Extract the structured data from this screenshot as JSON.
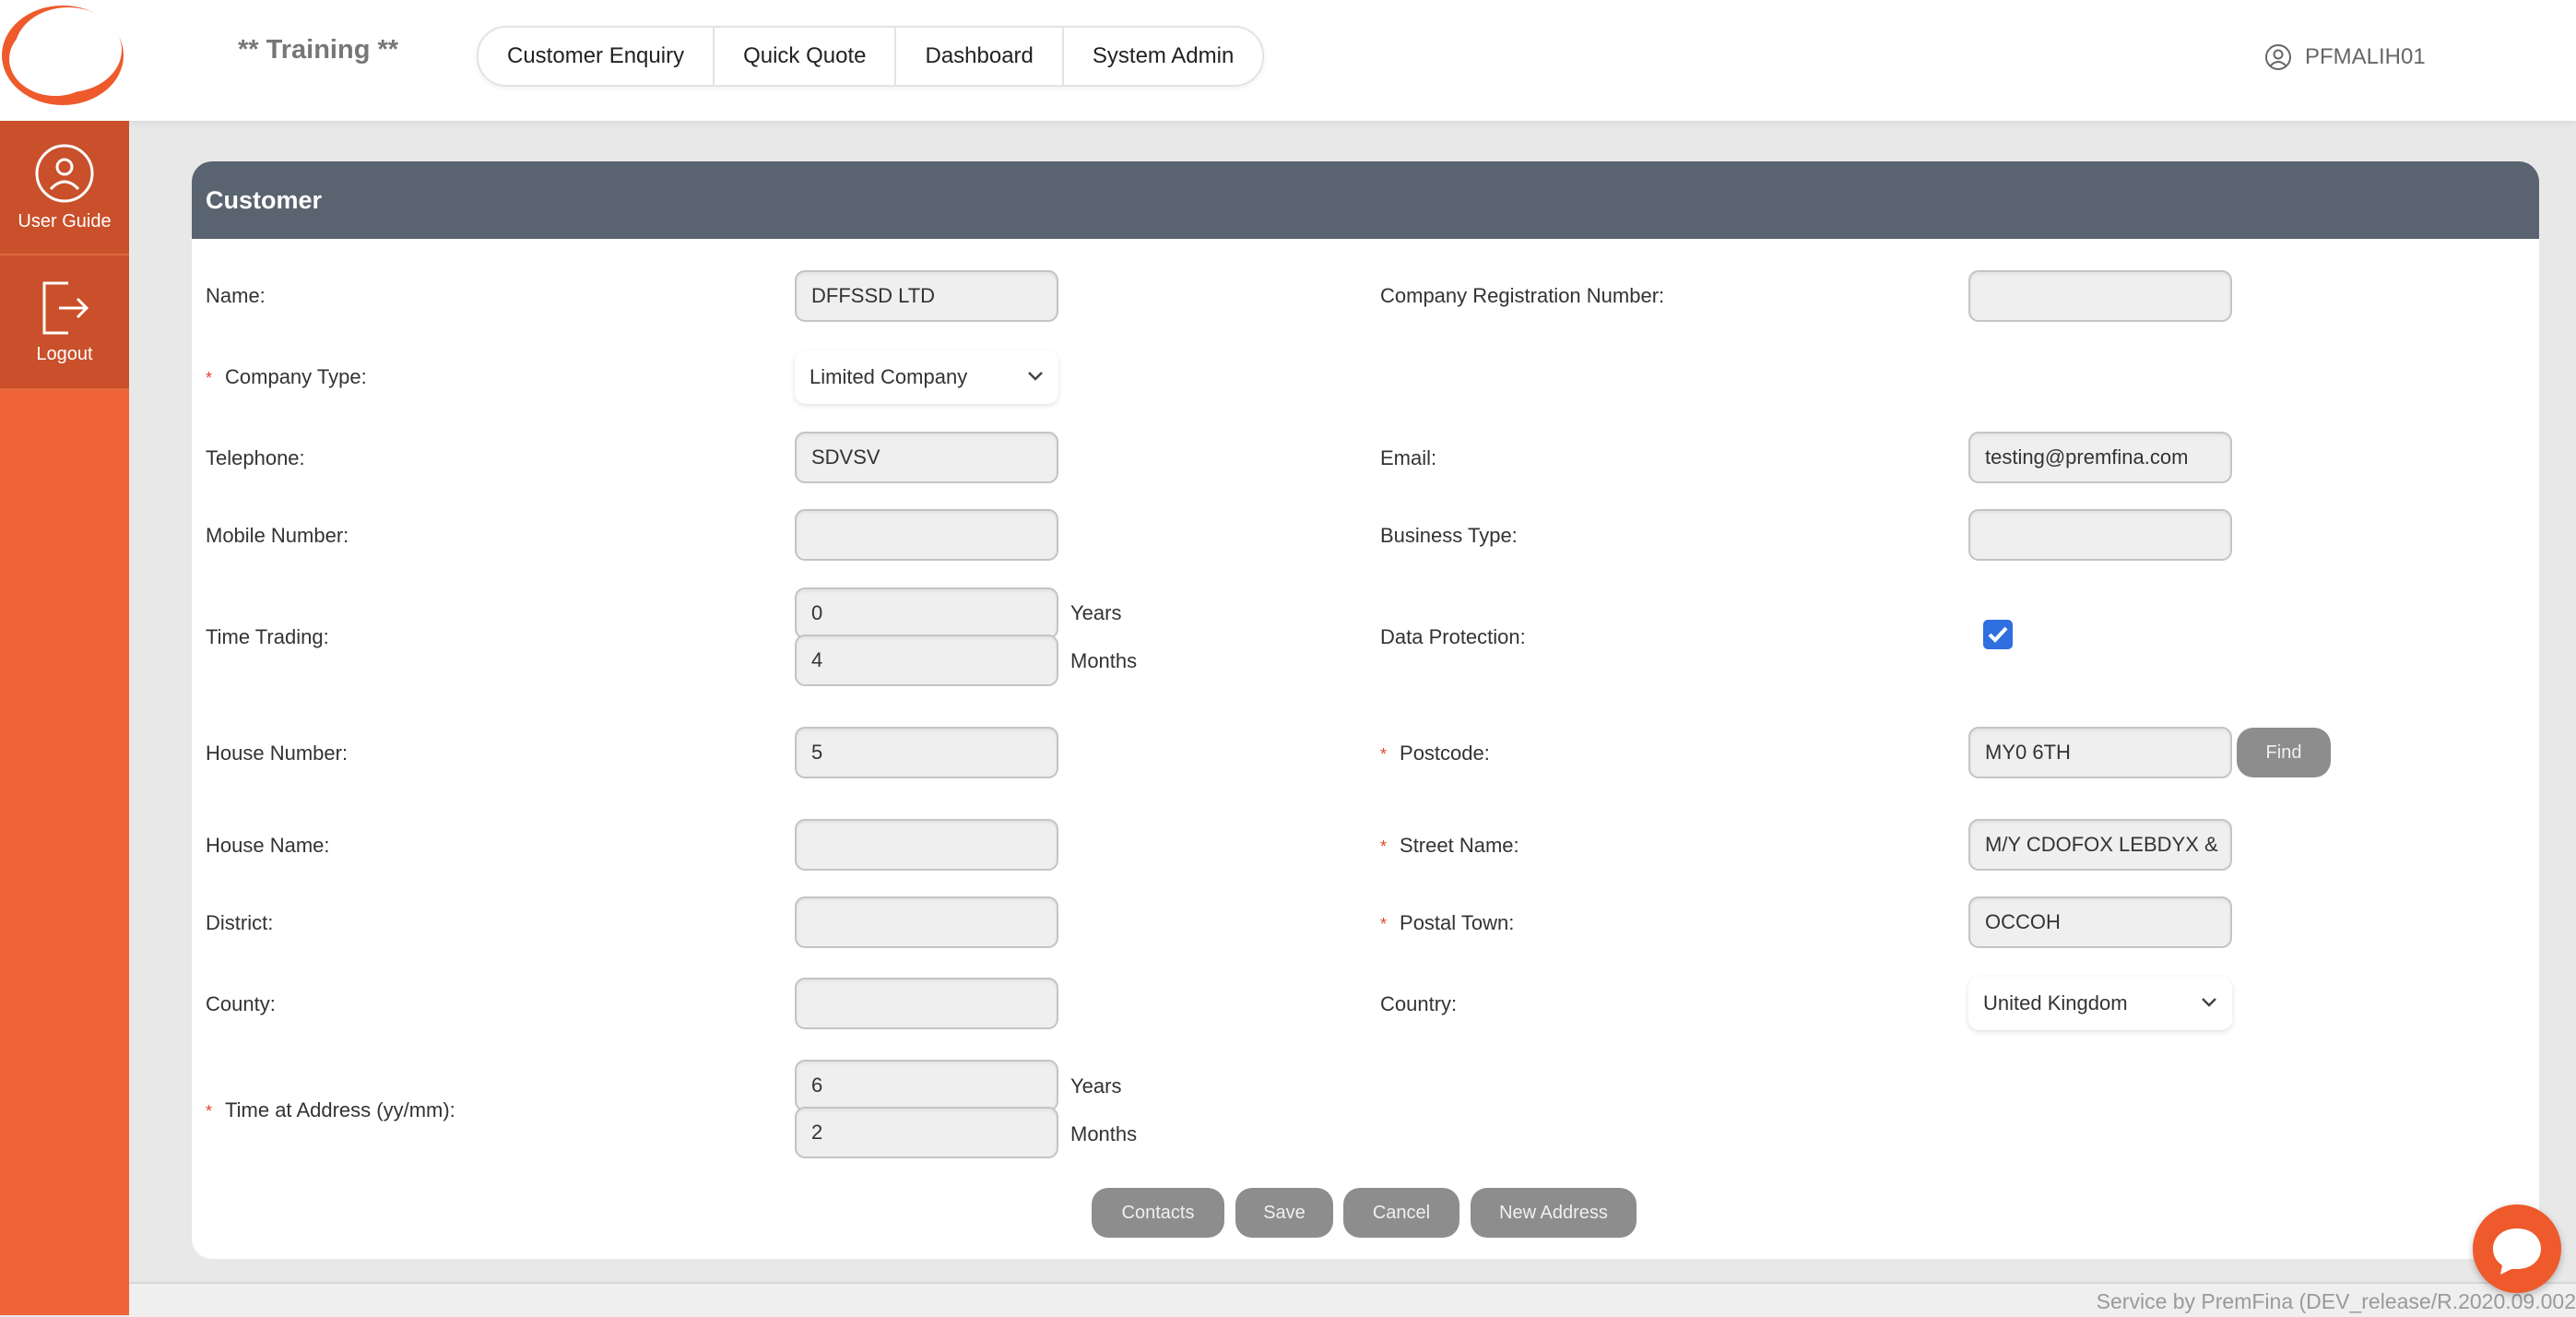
{
  "header": {
    "env_label": "** Training **",
    "nav": [
      "Customer Enquiry",
      "Quick Quote",
      "Dashboard",
      "System Admin"
    ],
    "username": "PFMALIH01"
  },
  "sidebar": {
    "user_guide": "User Guide",
    "logout": "Logout"
  },
  "card": {
    "title": "Customer",
    "name_label": "Name:",
    "name_value": "DFFSSD LTD",
    "company_reg_label": "Company Registration Number:",
    "company_reg_value": "",
    "company_type_label": "Company Type:",
    "company_type_value": "Limited Company",
    "telephone_label": "Telephone:",
    "telephone_value": "SDVSV",
    "email_label": "Email:",
    "email_value": "testing@premfina.com",
    "mobile_label": "Mobile Number:",
    "mobile_value": "",
    "business_type_label": "Business Type:",
    "business_type_value": "",
    "time_trading_label": "Time Trading:",
    "time_trading_years": "0",
    "time_trading_months": "4",
    "years_unit": "Years",
    "months_unit": "Months",
    "data_protection_label": "Data Protection:",
    "data_protection_checked": true,
    "house_number_label": "House Number:",
    "house_number_value": "5",
    "postcode_label": "Postcode:",
    "postcode_value": "MY0 6TH",
    "find_label": "Find",
    "house_name_label": "House Name:",
    "house_name_value": "",
    "street_name_label": "Street Name:",
    "street_name_value": "M/Y CDOFOX LEBDYX &",
    "district_label": "District:",
    "district_value": "",
    "postal_town_label": "Postal Town:",
    "postal_town_value": "OCCOH",
    "county_label": "County:",
    "county_value": "",
    "country_label": "Country:",
    "country_value": "United Kingdom",
    "time_at_address_label": "Time at Address (yy/mm):",
    "time_at_address_years": "6",
    "time_at_address_months": "2"
  },
  "actions": {
    "contacts": "Contacts",
    "save": "Save",
    "cancel": "Cancel",
    "new_address": "New Address"
  },
  "footer": {
    "text": "Service by PremFina (DEV_release/R.2020.09.002"
  },
  "colors": {
    "brand_orange": "#ee6436",
    "header_bar": "#596470",
    "button_grey": "#8d8d8d",
    "checkbox_blue": "#2f6fdf"
  }
}
